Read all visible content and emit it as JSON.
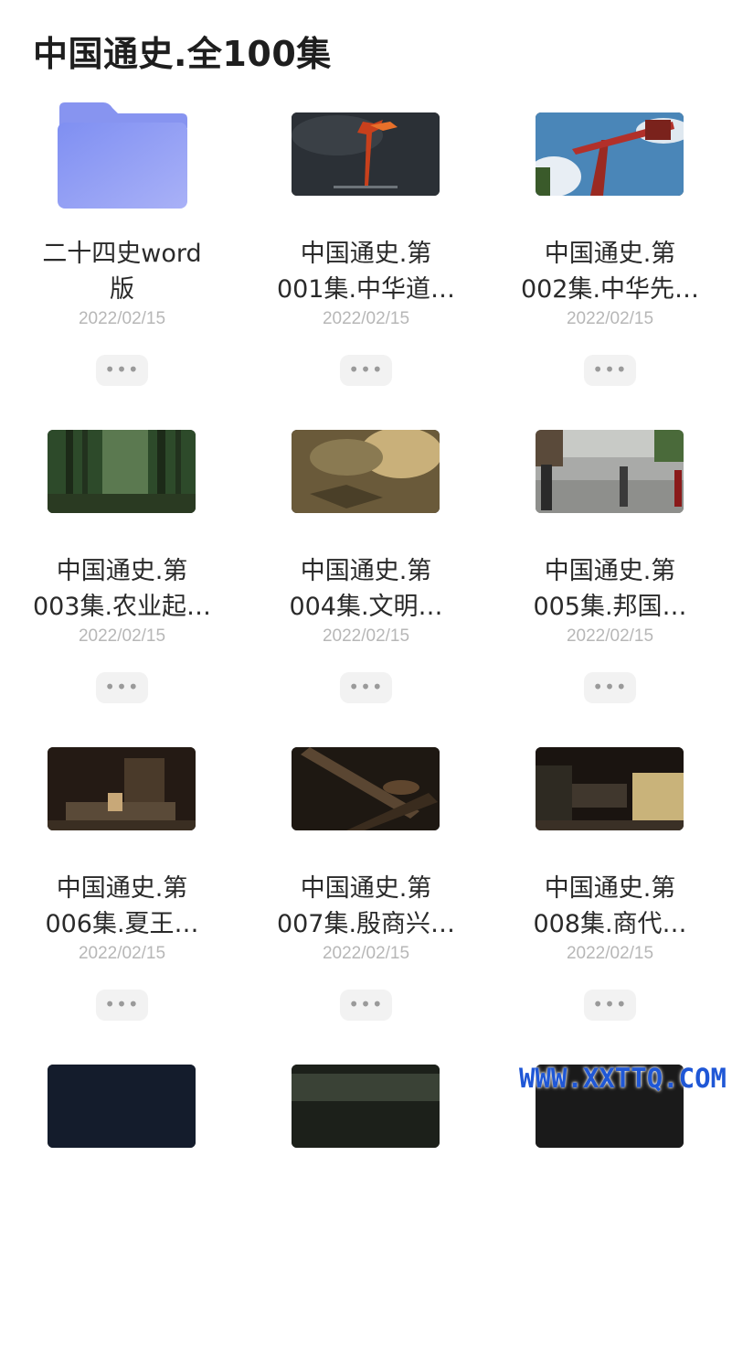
{
  "header": {
    "title": "中国通史.全100集"
  },
  "items": [
    {
      "type": "folder",
      "name_line1": "二十四史word",
      "name_line2": "版",
      "date": "2022/02/15",
      "more": "•••",
      "thumb_icon": "folder-icon"
    },
    {
      "type": "video",
      "name_line1": "中国通史.第",
      "name_line2": "001集.中华道…",
      "date": "2022/02/15",
      "more": "•••",
      "thumb_icon": "video-thumbnail"
    },
    {
      "type": "video",
      "name_line1": "中国通史.第",
      "name_line2": "002集.中华先…",
      "date": "2022/02/15",
      "more": "•••",
      "thumb_icon": "video-thumbnail"
    },
    {
      "type": "video",
      "name_line1": "中国通史.第",
      "name_line2": "003集.农业起…",
      "date": "2022/02/15",
      "more": "•••",
      "thumb_icon": "video-thumbnail"
    },
    {
      "type": "video",
      "name_line1": "中国通史.第",
      "name_line2": "004集.文明…",
      "date": "2022/02/15",
      "more": "•••",
      "thumb_icon": "video-thumbnail"
    },
    {
      "type": "video",
      "name_line1": "中国通史.第",
      "name_line2": "005集.邦国…",
      "date": "2022/02/15",
      "more": "•••",
      "thumb_icon": "video-thumbnail"
    },
    {
      "type": "video",
      "name_line1": "中国通史.第",
      "name_line2": "006集.夏王…",
      "date": "2022/02/15",
      "more": "•••",
      "thumb_icon": "video-thumbnail"
    },
    {
      "type": "video",
      "name_line1": "中国通史.第",
      "name_line2": "007集.殷商兴…",
      "date": "2022/02/15",
      "more": "•••",
      "thumb_icon": "video-thumbnail"
    },
    {
      "type": "video",
      "name_line1": "中国通史.第",
      "name_line2": "008集.商代…",
      "date": "2022/02/15",
      "more": "•••",
      "thumb_icon": "video-thumbnail"
    }
  ],
  "partial_row_icons": [
    "video-thumbnail",
    "video-thumbnail",
    "video-thumbnail"
  ],
  "watermark": "WWW.XXTTQ.COM",
  "colors": {
    "folder": "#8e9bf3",
    "date": "#b7b7b7",
    "more_bg": "#f2f2f2",
    "watermark": "#1f57d6"
  }
}
